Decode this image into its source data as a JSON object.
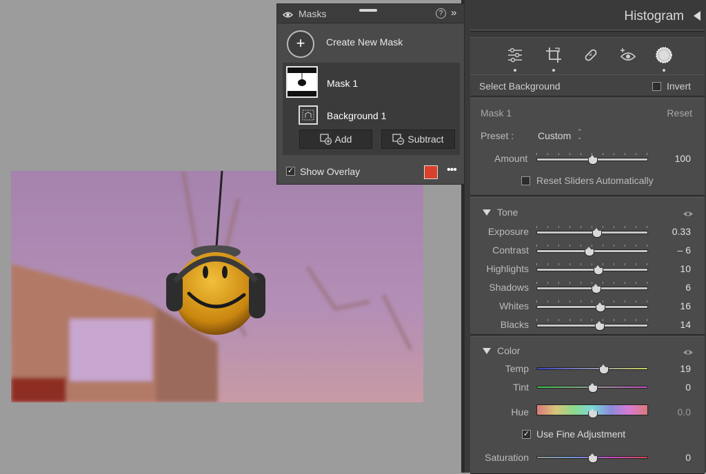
{
  "masks_panel": {
    "title": "Masks",
    "create_new_mask": "Create New Mask",
    "mask_name": "Mask 1",
    "component_name": "Background 1",
    "add_label": "Add",
    "subtract_label": "Subtract",
    "show_overlay_label": "Show Overlay",
    "show_overlay_checked": true,
    "overlay_color": "#d9412b",
    "help_glyph": "?",
    "collapse_glyph": "»",
    "more_glyph": "•••",
    "plus_glyph": "+"
  },
  "panel": {
    "histogram_title": "Histogram",
    "tools": [
      "edit-sliders-icon",
      "crop-icon",
      "healing-bandage-icon",
      "red-eye-icon",
      "masking-icon"
    ],
    "select_background": "Select Background",
    "invert_label": "Invert",
    "mask_section": {
      "name": "Mask 1",
      "reset": "Reset",
      "preset_label": "Preset :",
      "preset_value": "Custom",
      "preset_arrows": "⌃⌄",
      "amount_label": "Amount",
      "amount_value": "100",
      "amount_fraction": 0.5,
      "reset_sliders_label": "Reset Sliders Automatically"
    },
    "tone": {
      "title": "Tone",
      "sliders": [
        {
          "label": "Exposure",
          "value": "0.33",
          "fraction": 0.54
        },
        {
          "label": "Contrast",
          "value": "– 6",
          "fraction": 0.47
        },
        {
          "label": "Highlights",
          "value": "10",
          "fraction": 0.55
        },
        {
          "label": "Shadows",
          "value": "6",
          "fraction": 0.53
        },
        {
          "label": "Whites",
          "value": "16",
          "fraction": 0.57
        },
        {
          "label": "Blacks",
          "value": "14",
          "fraction": 0.56
        }
      ]
    },
    "color": {
      "title": "Color",
      "temp_label": "Temp",
      "temp_value": "19",
      "temp_fraction": 0.6,
      "tint_label": "Tint",
      "tint_value": "0",
      "tint_fraction": 0.5,
      "hue_label": "Hue",
      "hue_value": "0.0",
      "hue_fraction": 0.5,
      "fine_adjust_label": "Use Fine Adjustment",
      "fine_adjust_checked": true,
      "saturation_label": "Saturation",
      "saturation_value": "0",
      "saturation_fraction": 0.5
    }
  }
}
